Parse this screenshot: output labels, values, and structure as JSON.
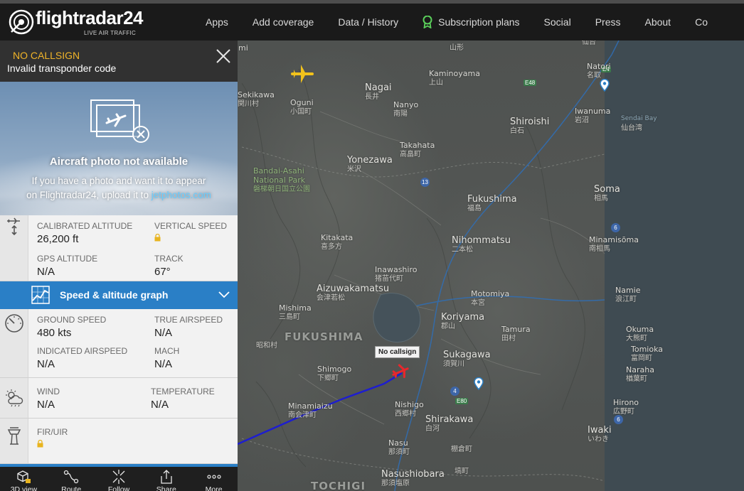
{
  "brand": {
    "name": "flightradar24",
    "tagline": "LIVE AIR TRAFFIC",
    "accent": "#f0b429"
  },
  "nav": {
    "items": [
      "Apps",
      "Add coverage",
      "Data / History",
      "Subscription plans",
      "Social",
      "Press",
      "About",
      "Co"
    ]
  },
  "panel": {
    "callsign": "NO CALLSIGN",
    "description": "Invalid transponder code",
    "photo": {
      "title": "Aircraft photo not available",
      "line1": "If you have a photo and want it to appear",
      "line2_prefix": "on Flightradar24, upload it to ",
      "link": "jetphotos.com"
    },
    "altitude": {
      "calibrated_label": "CALIBRATED ALTITUDE",
      "calibrated_value": "26,200 ft",
      "vertical_label": "VERTICAL SPEED",
      "gps_label": "GPS ALTITUDE",
      "gps_value": "N/A",
      "track_label": "TRACK",
      "track_value": "67°"
    },
    "graph_bar_label": "Speed & altitude graph",
    "speed": {
      "ground_label": "GROUND SPEED",
      "ground_value": "480 kts",
      "true_label": "TRUE AIRSPEED",
      "true_value": "N/A",
      "indicated_label": "INDICATED AIRSPEED",
      "indicated_value": "N/A",
      "mach_label": "MACH",
      "mach_value": "N/A"
    },
    "weather": {
      "wind_label": "WIND",
      "wind_value": "N/A",
      "temp_label": "TEMPERATURE",
      "temp_value": "N/A"
    },
    "fir": {
      "label": "FIR/UIR"
    },
    "toolbar": [
      "3D view",
      "Route",
      "Follow",
      "Share",
      "More"
    ]
  },
  "map": {
    "callsign_tag": "No callsign",
    "places": {
      "sendai": "仙台",
      "natori": "Natori",
      "natori_k": "名取",
      "iwanuma": "Iwanuma",
      "iwanuma_k": "岩沼",
      "sendai_bay": "Sendai Bay",
      "sendai_bay_k": "仙台湾",
      "sekikawa": "Sekikawa",
      "sekikawa_k": "関川村",
      "oguni": "Oguni",
      "oguni_k": "小国町",
      "nagai": "Nagai",
      "nagai_k": "長井",
      "kaminoyama": "Kaminoyama",
      "kaminoyama_k": "上山",
      "yamagata_k": "山形",
      "nanyo": "Nanyo",
      "nanyo_k": "南陽",
      "shiroishi": "Shiroishi",
      "shiroishi_k": "白石",
      "takahata": "Takahata",
      "takahata_k": "高畠町",
      "yonezawa": "Yonezawa",
      "yonezawa_k": "米沢",
      "bandai": "Bandai-Asahi",
      "bandai2": "National Park",
      "bandai_k": "磐梯朝日国立公園",
      "fukushima": "Fukushima",
      "fukushima_k": "福島",
      "soma": "Soma",
      "soma_k": "相馬",
      "minamisoma": "Minamisōma",
      "minamisoma_k": "南相馬",
      "kitakata": "Kitakata",
      "kitakata_k": "喜多方",
      "nihonmatsu": "Nihommatsu",
      "nihonmatsu_k": "二本松",
      "inawashiro": "Inawashiro",
      "inawashiro_k": "猪苗代町",
      "motomiya": "Motomiya",
      "motomiya_k": "本宮",
      "aizu": "Aizuwakamatsu",
      "aizu_k": "会津若松",
      "namie": "Namie",
      "namie_k": "浪江町",
      "mishima": "Mishima",
      "mishima_k": "三島町",
      "koriyama": "Koriyama",
      "koriyama_k": "郡山",
      "tamura": "Tamura",
      "tamura_k": "田村",
      "okuma": "Okuma",
      "okuma_k": "大熊町",
      "tomioka": "Tomioka",
      "tomioka_k": "富岡町",
      "naraha": "Naraha",
      "naraha_k": "楢葉町",
      "fukushima_region": "FUKUSHIMA",
      "showa_k": "昭和村",
      "sukagawa": "Sukagawa",
      "sukagawa_k": "須賀川",
      "shimogo": "Shimogo",
      "shimogo_k": "下郷町",
      "minamiaizu": "Minamiaizu",
      "minamiaizu_k": "南会津町",
      "nishigo": "Nishigo",
      "nishigo_k": "西郷村",
      "shirakawa": "Shirakawa",
      "shirakawa_k": "白河",
      "hirono": "Hirono",
      "hirono_k": "広野町",
      "iwaki": "Iwaki",
      "iwaki_k": "いわき",
      "nasu": "Nasu",
      "nasu_k": "那須町",
      "tanagura_k": "棚倉町",
      "hanawa_k": "塙町",
      "nasushiobara": "Nasushiobara",
      "nasushiobara_k": "那須塩原",
      "tochigi": "TOCHIGI",
      "mi": "mi"
    },
    "roads": [
      "E48",
      "E4",
      "13",
      "6",
      "4",
      "E80",
      "6"
    ]
  }
}
